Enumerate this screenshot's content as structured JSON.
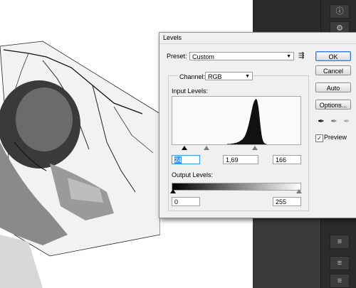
{
  "dialog": {
    "title": "Levels",
    "preset_label": "Preset:",
    "preset_value": "Custom",
    "channel_label": "Channel:",
    "channel_value": "RGB",
    "input_levels_label": "Input Levels:",
    "input_black": "24",
    "input_gamma": "1,69",
    "input_white": "166",
    "output_levels_label": "Output Levels:",
    "output_black": "0",
    "output_white": "255",
    "buttons": {
      "ok": "OK",
      "cancel": "Cancel",
      "auto": "Auto",
      "options": "Options..."
    },
    "preview_label": "Preview",
    "preview_checked": true
  },
  "histogram": {
    "levels": [
      0,
      0,
      0,
      0,
      0,
      0,
      0,
      0,
      0,
      0,
      0,
      0,
      0,
      0,
      0,
      0,
      0,
      0,
      0,
      0,
      0,
      0,
      0,
      0,
      0,
      0,
      0,
      0,
      0,
      0,
      0,
      0,
      0,
      0,
      0,
      0,
      0,
      0,
      0,
      0,
      0,
      0,
      0,
      0,
      0,
      0,
      0,
      0,
      0,
      0,
      0,
      0,
      0,
      0,
      0,
      0,
      0,
      0,
      0,
      0,
      0,
      0,
      0,
      0,
      0,
      0,
      0,
      0,
      0,
      0,
      0,
      0,
      0,
      0,
      0,
      0,
      0,
      0,
      0,
      0,
      0,
      1,
      1,
      1,
      1,
      1,
      1,
      2,
      2,
      2,
      2,
      3,
      3,
      3,
      4,
      4,
      5,
      5,
      6,
      7,
      8,
      9,
      10,
      11,
      13,
      15,
      17,
      20,
      24,
      28,
      33,
      38,
      44,
      50,
      57,
      64,
      71,
      78,
      85,
      90,
      94,
      97,
      99,
      100,
      98,
      93,
      85,
      74,
      60,
      45,
      32,
      21,
      13,
      8,
      5,
      3,
      2,
      1,
      1,
      0,
      0,
      0,
      0,
      0,
      0,
      0,
      0,
      0,
      0,
      0,
      0,
      0,
      0,
      0,
      0,
      0,
      0,
      0,
      0,
      0,
      0,
      0,
      0,
      0,
      0,
      0,
      0,
      0,
      0,
      0,
      0,
      0,
      0,
      0,
      0,
      0,
      0,
      0,
      0,
      0,
      0,
      0,
      0,
      0,
      0,
      0,
      0,
      0
    ],
    "fill_color": "#111111"
  },
  "colors": {
    "accent": "#3399ff",
    "panel_bg": "#2b2b2b"
  },
  "panel_icons": [
    "info-icon",
    "adjust-icon"
  ]
}
